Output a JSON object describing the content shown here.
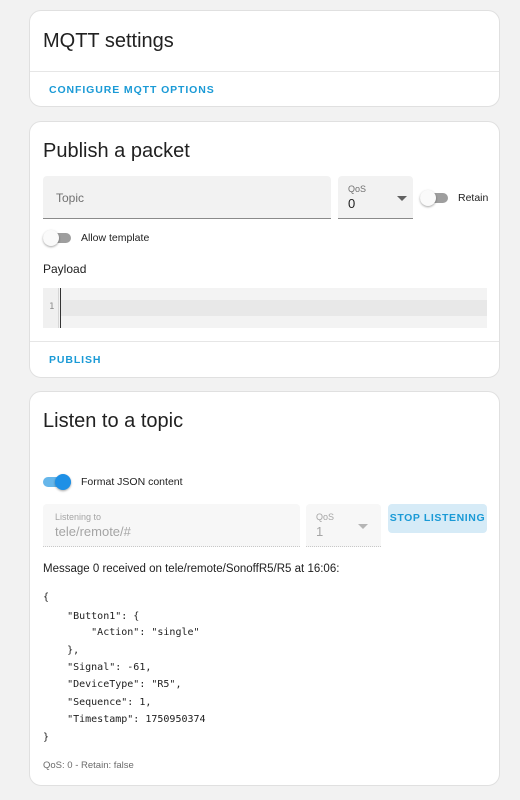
{
  "mqtt_settings": {
    "title": "MQTT settings",
    "configure_label": "CONFIGURE MQTT OPTIONS"
  },
  "publish": {
    "title": "Publish a packet",
    "topic_placeholder": "Topic",
    "qos_label": "QoS",
    "qos_value": "0",
    "retain_label": "Retain",
    "retain_on": false,
    "allow_template_label": "Allow template",
    "allow_template_on": false,
    "payload_label": "Payload",
    "editor_line_number": "1",
    "publish_label": "PUBLISH"
  },
  "listen": {
    "title": "Listen to a topic",
    "format_json_label": "Format JSON content",
    "format_json_on": true,
    "listening_to_label": "Listening to",
    "listening_to_value": "tele/remote/#",
    "qos_label": "QoS",
    "qos_value": "1",
    "stop_label": "STOP LISTENING",
    "message_heading": "Message 0 received on tele/remote/SonoffR5/R5 at 16:06:",
    "message_lines": [
      "{",
      "    \"Button1\": {",
      "        \"Action\": \"single\"",
      "    },",
      "    \"Signal\": -61,",
      "    \"DeviceType\": \"R5\",",
      "    \"Sequence\": 1,",
      "    \"Timestamp\": 1750950374",
      "}"
    ],
    "message_footer": "QoS: 0 - Retain: false"
  },
  "colors": {
    "accent": "#1a9ad6",
    "switch_on": "#1e90e6",
    "background": "#f2f2f2"
  }
}
